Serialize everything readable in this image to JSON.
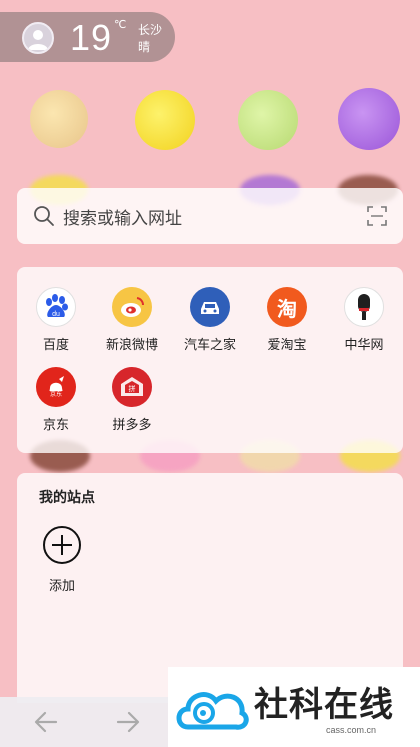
{
  "weather": {
    "temperature": "19",
    "unit": "℃",
    "city": "长沙",
    "condition": "晴"
  },
  "search": {
    "placeholder": "搜索或输入网址"
  },
  "quick_links": [
    {
      "label": "百度",
      "icon": "baidu-icon",
      "color": "#2b5be8"
    },
    {
      "label": "新浪微博",
      "icon": "weibo-icon",
      "color": "#f7c544"
    },
    {
      "label": "汽车之家",
      "icon": "car-icon",
      "color": "#2f5fb9"
    },
    {
      "label": "爱淘宝",
      "icon": "taobao-icon",
      "color": "#f15a1e"
    },
    {
      "label": "中华网",
      "icon": "microphone-icon",
      "color": "#1f1f1f"
    },
    {
      "label": "京东",
      "icon": "jd-icon",
      "color": "#e1251b"
    },
    {
      "label": "拼多多",
      "icon": "pinduoduo-icon",
      "color": "#d7262b"
    }
  ],
  "my_sites": {
    "title": "我的站点",
    "add_label": "添加"
  },
  "watermark": {
    "text": "社科在线",
    "sub": "cass.com.cn"
  }
}
